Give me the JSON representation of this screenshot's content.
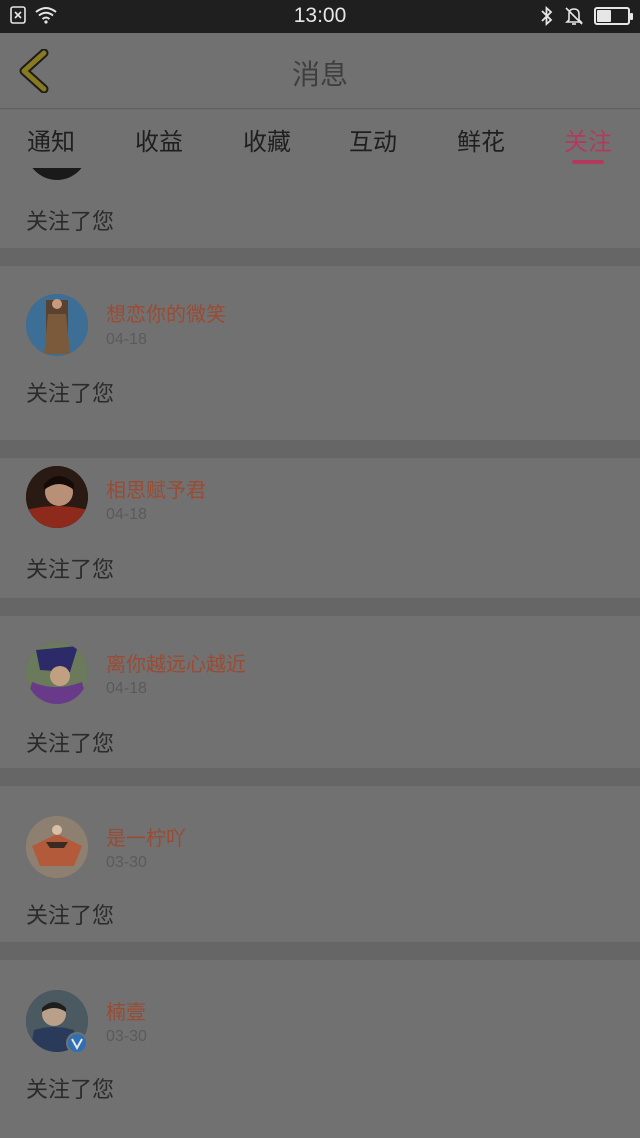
{
  "status_bar": {
    "time": "13:00",
    "icons": [
      "sim-off-icon",
      "wifi-icon",
      "bluetooth-icon",
      "bell-off-icon",
      "battery-icon"
    ],
    "battery_level": 0.45
  },
  "header": {
    "title": "消息",
    "back_icon": "chevron-left-icon"
  },
  "tabs": [
    {
      "label": "通知",
      "active": false
    },
    {
      "label": "收益",
      "active": false
    },
    {
      "label": "收藏",
      "active": false
    },
    {
      "label": "互动",
      "active": false
    },
    {
      "label": "鲜花",
      "active": false
    },
    {
      "label": "关注",
      "active": true
    }
  ],
  "feed": [
    {
      "username": "",
      "date": "",
      "message": "关注了您",
      "partial": true
    },
    {
      "username": "想恋你的微笑",
      "date": "04-18",
      "message": "关注了您"
    },
    {
      "username": "相思赋予君",
      "date": "04-18",
      "message": "关注了您"
    },
    {
      "username": "离你越远心越近",
      "date": "04-18",
      "message": "关注了您"
    },
    {
      "username": "是一柠吖",
      "date": "03-30",
      "message": "关注了您"
    },
    {
      "username": "楠壹",
      "date": "03-30",
      "message": "关注了您",
      "verified": true
    }
  ],
  "colors": {
    "accent": "#b13a5e",
    "username": "#9a4b33",
    "overlay_bg": "#717171"
  }
}
